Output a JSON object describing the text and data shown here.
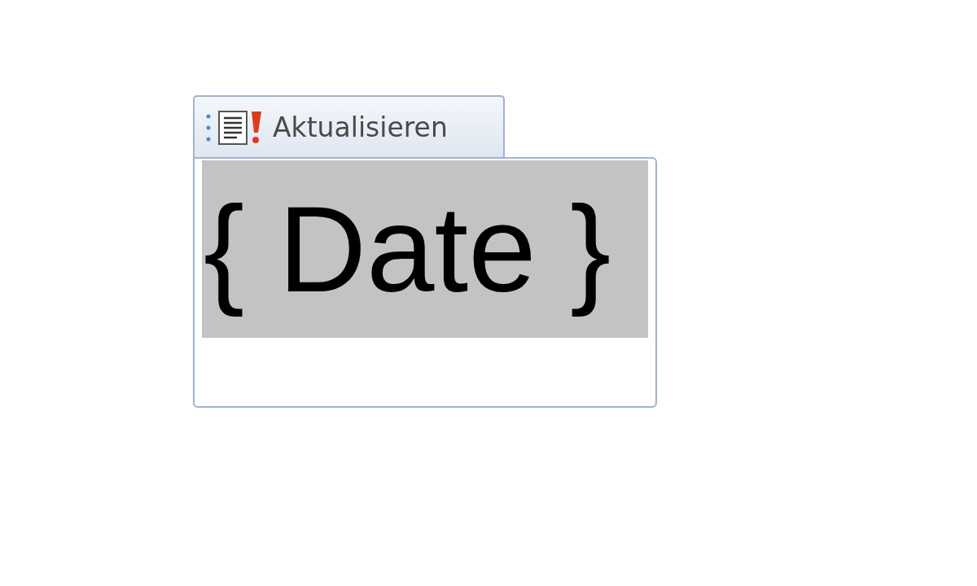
{
  "content_control": {
    "tab": {
      "label": "Aktualisieren"
    },
    "field": {
      "text": "{ Date }",
      "shaded": true
    }
  }
}
